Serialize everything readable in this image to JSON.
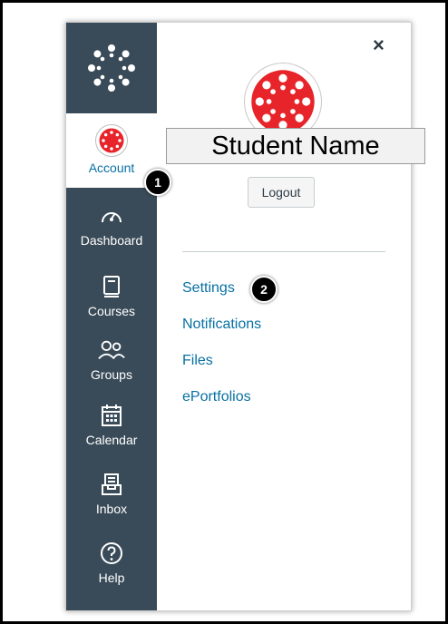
{
  "nav": {
    "account_label": "Account",
    "items": [
      {
        "label": "Dashboard",
        "icon": "dashboard-gauge-icon"
      },
      {
        "label": "Courses",
        "icon": "book-icon"
      },
      {
        "label": "Groups",
        "icon": "groups-icon"
      },
      {
        "label": "Calendar",
        "icon": "calendar-icon"
      },
      {
        "label": "Inbox",
        "icon": "inbox-icon"
      },
      {
        "label": "Help",
        "icon": "help-icon"
      }
    ]
  },
  "tray": {
    "close_glyph": "×",
    "user_name": "Student Name",
    "logout_label": "Logout",
    "links": [
      "Settings",
      "Notifications",
      "Files",
      "ePortfolios"
    ]
  },
  "markers": [
    "1",
    "2"
  ],
  "colors": {
    "nav_bg": "#394b58",
    "link": "#0770a3",
    "brand_red": "#e72429"
  }
}
